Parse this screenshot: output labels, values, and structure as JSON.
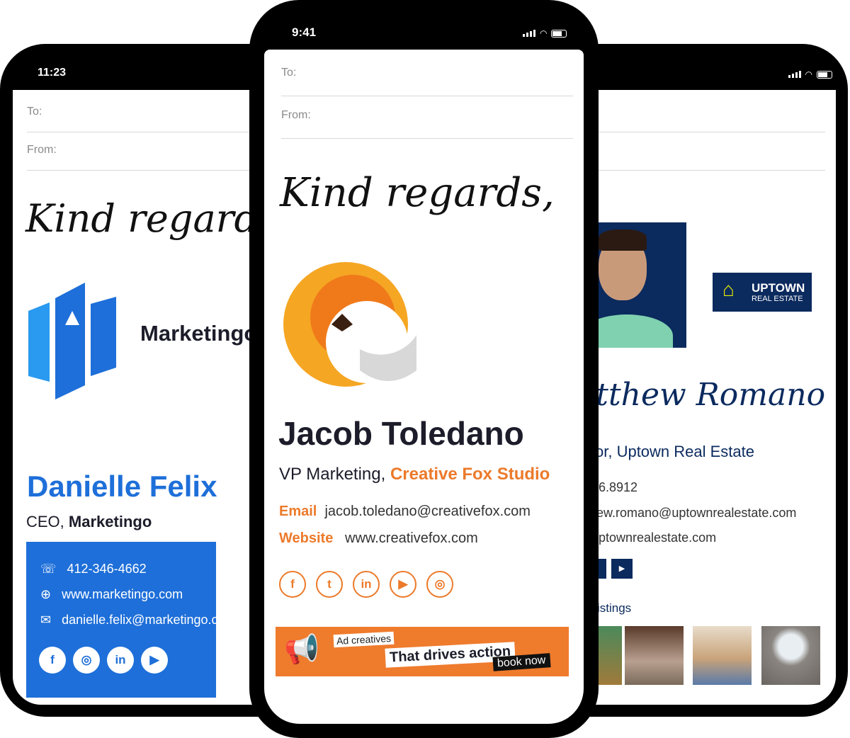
{
  "left_phone": {
    "time": "11:23",
    "to_label": "To:",
    "from_label": "From:",
    "closing": "Kind regards,",
    "company": "Marketingo",
    "name": "Danielle Felix",
    "title_prefix": "CEO, ",
    "title_company": "Marketingo",
    "phone": "412-346-4662",
    "website": "www.marketingo.com",
    "email": "danielle.felix@marketingo.com",
    "socials": [
      "facebook-icon",
      "instagram-icon",
      "linkedin-icon",
      "youtube-icon"
    ],
    "accent": "#1e6fd9"
  },
  "center_phone": {
    "time": "9:41",
    "to_label": "To:",
    "from_label": "From:",
    "closing": "Kind regards,",
    "name": "Jacob Toledano",
    "title_prefix": "VP Marketing, ",
    "title_company": "Creative Fox Studio",
    "email_label": "Email",
    "email": "jacob.toledano@creativefox.com",
    "website_label": "Website",
    "website": "www.creativefox.com",
    "socials": [
      "facebook-icon",
      "twitter-icon",
      "linkedin-icon",
      "youtube-icon",
      "instagram-icon"
    ],
    "banner": {
      "line1": "Ad creatives",
      "line2": "That drives action",
      "cta": "book now"
    },
    "accent": "#ec7a2a"
  },
  "right_phone": {
    "logo_line1": "UPTOWN",
    "logo_line2": "REAL ESTATE",
    "signature": "Matthew Romano",
    "title": "or, Uptown Real Estate",
    "phone": "6.8912",
    "email": "ew.romano@uptownrealestate.com",
    "website": "ptownrealestate.com",
    "listings_label": "istings",
    "socials": [
      "linkedin-icon",
      "youtube-icon"
    ],
    "accent": "#0b2a5e"
  }
}
